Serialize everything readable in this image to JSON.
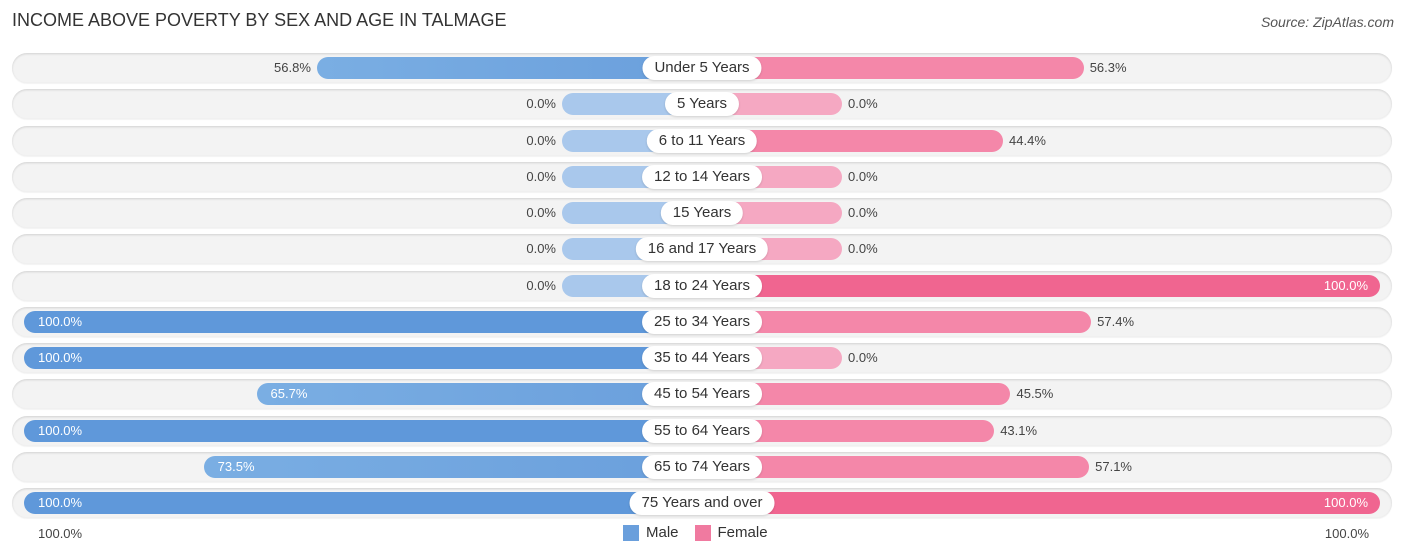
{
  "chart_data": {
    "type": "bar",
    "orientation": "horizontal-diverging",
    "title": "INCOME ABOVE POVERTY BY SEX AND AGE IN TALMAGE",
    "source": "Source: ZipAtlas.com",
    "categories": [
      "Under 5 Years",
      "5 Years",
      "6 to 11 Years",
      "12 to 14 Years",
      "15 Years",
      "16 and 17 Years",
      "18 to 24 Years",
      "25 to 34 Years",
      "35 to 44 Years",
      "45 to 54 Years",
      "55 to 64 Years",
      "65 to 74 Years",
      "75 Years and over"
    ],
    "series": [
      {
        "name": "Male",
        "color": "#6a9fdc",
        "values": [
          56.8,
          0.0,
          0.0,
          0.0,
          0.0,
          0.0,
          0.0,
          100.0,
          100.0,
          65.7,
          100.0,
          73.5,
          100.0
        ]
      },
      {
        "name": "Female",
        "color": "#f07aa0",
        "values": [
          56.3,
          0.0,
          44.4,
          0.0,
          0.0,
          0.0,
          100.0,
          57.4,
          0.0,
          45.5,
          43.1,
          57.1,
          100.0
        ]
      }
    ],
    "value_labels": {
      "Male": [
        "56.8%",
        "0.0%",
        "0.0%",
        "0.0%",
        "0.0%",
        "0.0%",
        "0.0%",
        "100.0%",
        "100.0%",
        "65.7%",
        "100.0%",
        "73.5%",
        "100.0%"
      ],
      "Female": [
        "56.3%",
        "0.0%",
        "44.4%",
        "0.0%",
        "0.0%",
        "0.0%",
        "100.0%",
        "57.4%",
        "0.0%",
        "45.5%",
        "43.1%",
        "57.1%",
        "100.0%"
      ]
    },
    "xlim": [
      0,
      100
    ],
    "axis_labels": {
      "left": "100.0%",
      "right": "100.0%"
    },
    "legend": {
      "position": "bottom-center",
      "entries": [
        "Male",
        "Female"
      ]
    },
    "zero_stub_colors": {
      "Male": "#a9c8ec",
      "Female": "#f5a8c2"
    }
  }
}
